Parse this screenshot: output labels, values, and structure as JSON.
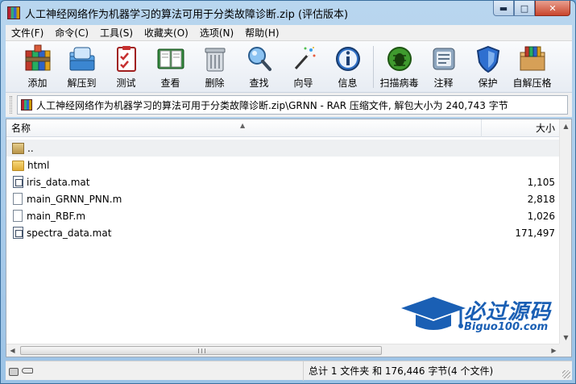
{
  "window": {
    "title": "人工神经网络作为机器学习的算法可用于分类故障诊断.zip (评估版本)"
  },
  "menu": [
    {
      "label": "文件(F)"
    },
    {
      "label": "命令(C)"
    },
    {
      "label": "工具(S)"
    },
    {
      "label": "收藏夹(O)"
    },
    {
      "label": "选项(N)"
    },
    {
      "label": "帮助(H)"
    }
  ],
  "toolbar": {
    "group1": [
      {
        "label": "添加",
        "icon": "books-add-icon"
      },
      {
        "label": "解压到",
        "icon": "folder-extract-icon"
      },
      {
        "label": "测试",
        "icon": "clipboard-test-icon"
      },
      {
        "label": "查看",
        "icon": "book-view-icon"
      },
      {
        "label": "删除",
        "icon": "trash-icon"
      },
      {
        "label": "查找",
        "icon": "magnifier-icon"
      },
      {
        "label": "向导",
        "icon": "wand-icon"
      },
      {
        "label": "信息",
        "icon": "info-icon"
      }
    ],
    "group2": [
      {
        "label": "扫描病毒",
        "icon": "bug-scan-icon"
      },
      {
        "label": "注释",
        "icon": "comment-icon"
      },
      {
        "label": "保护",
        "icon": "shield-icon"
      },
      {
        "label": "自解压格",
        "icon": "sfx-box-icon"
      }
    ]
  },
  "pathbar": {
    "text": "人工神经网络作为机器学习的算法可用于分类故障诊断.zip\\GRNN - RAR 压缩文件, 解包大小为 240,743 字节"
  },
  "filelist": {
    "columns": {
      "name": "名称",
      "size": "大小"
    },
    "rows": [
      {
        "name": "..",
        "size": "",
        "kind": "folder-up"
      },
      {
        "name": "html",
        "size": "",
        "kind": "folder"
      },
      {
        "name": "iris_data.mat",
        "size": "1,105",
        "kind": "mat"
      },
      {
        "name": "main_GRNN_PNN.m",
        "size": "2,818",
        "kind": "doc"
      },
      {
        "name": "main_RBF.m",
        "size": "1,026",
        "kind": "doc"
      },
      {
        "name": "spectra_data.mat",
        "size": "171,497",
        "kind": "mat"
      }
    ]
  },
  "watermark": {
    "text": "必过源码",
    "sub": "Biguo100.com"
  },
  "status": {
    "text": "总计 1 文件夹 和 176,446 字节(4 个文件)"
  },
  "colors": {
    "accent": "#1a5fb4",
    "titlebar": "#b9d6ef"
  }
}
